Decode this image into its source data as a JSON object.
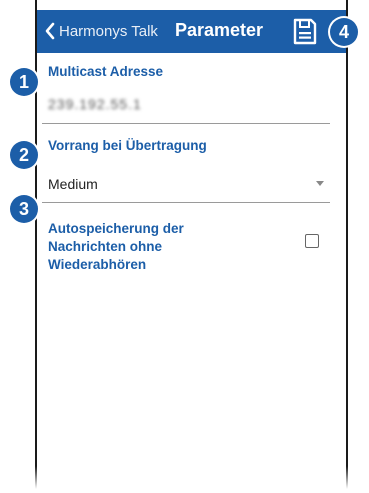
{
  "header": {
    "back_label": "Harmonys Talk",
    "title": "Parameter",
    "back_icon": "chevron-left-icon",
    "save_icon": "floppy-disk-icon",
    "color": "#1c5ea8"
  },
  "fields": {
    "multicast": {
      "label": "Multicast Adresse",
      "value": "239.192.55.1"
    },
    "priority": {
      "label": "Vorrang bei Übertragung",
      "value": "Medium"
    },
    "autosave": {
      "label_line1": "Autospeicherung der",
      "label_line2": "Nachrichten ohne",
      "label_line3": "Wiederabhören",
      "checked": false
    }
  },
  "badges": [
    "1",
    "2",
    "3",
    "4"
  ]
}
